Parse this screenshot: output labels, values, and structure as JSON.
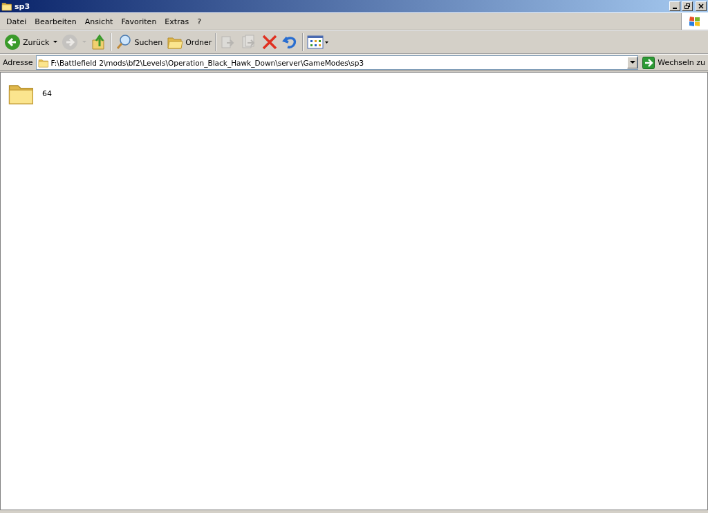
{
  "window": {
    "title": "sp3"
  },
  "menu": [
    "Datei",
    "Bearbeiten",
    "Ansicht",
    "Favoriten",
    "Extras",
    "?"
  ],
  "toolbar": [
    {
      "kind": "back",
      "label": "Zurück",
      "disabled": false
    },
    {
      "kind": "forward",
      "disabled": true
    },
    {
      "kind": "up",
      "disabled": false
    },
    {
      "kind": "sep"
    },
    {
      "kind": "search",
      "label": "Suchen",
      "disabled": false
    },
    {
      "kind": "folders",
      "label": "Ordner",
      "disabled": false
    },
    {
      "kind": "sep"
    },
    {
      "kind": "move",
      "disabled": true
    },
    {
      "kind": "copy",
      "disabled": true
    },
    {
      "kind": "delete",
      "disabled": false
    },
    {
      "kind": "undo",
      "disabled": false
    },
    {
      "kind": "sep"
    },
    {
      "kind": "views",
      "disabled": false
    }
  ],
  "address": {
    "label": "Adresse",
    "value": "F:\\Battlefield 2\\mods\\bf2\\Levels\\Operation_Black_Hawk_Down\\server\\GameModes\\sp3",
    "go": "Wechseln zu"
  },
  "files": [
    {
      "name": "64"
    }
  ]
}
